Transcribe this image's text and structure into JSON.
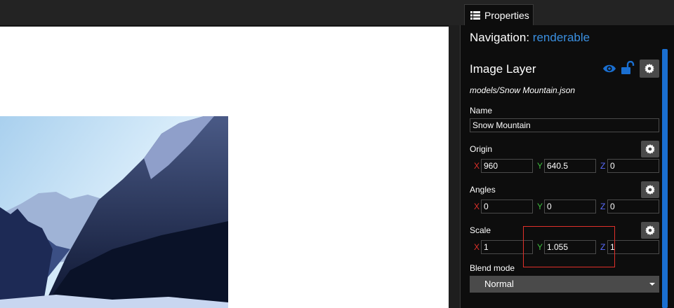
{
  "tab": {
    "label": "Properties",
    "icon": "list-icon"
  },
  "navigation": {
    "label": "Navigation:",
    "value": "renderable"
  },
  "layer": {
    "title": "Image Layer",
    "path": "models/Snow Mountain.json",
    "icons": [
      "eye-icon",
      "unlock-icon",
      "gear-icon"
    ]
  },
  "name": {
    "label": "Name",
    "value": "Snow Mountain"
  },
  "origin": {
    "label": "Origin",
    "x": "960",
    "y": "640.5",
    "z": "0"
  },
  "angles": {
    "label": "Angles",
    "x": "0",
    "y": "0",
    "z": "0"
  },
  "scale": {
    "label": "Scale",
    "x": "1",
    "y": "1.055",
    "z": "1"
  },
  "axes": {
    "x": "X",
    "y": "Y",
    "z": "Z"
  },
  "blend": {
    "label": "Blend mode",
    "value": "Normal"
  },
  "colors": {
    "accent": "#3a8fe0",
    "axis_x": "#e0302a",
    "axis_y": "#3fbf3f",
    "axis_z": "#5a6cff",
    "highlight": "#e0302a"
  }
}
